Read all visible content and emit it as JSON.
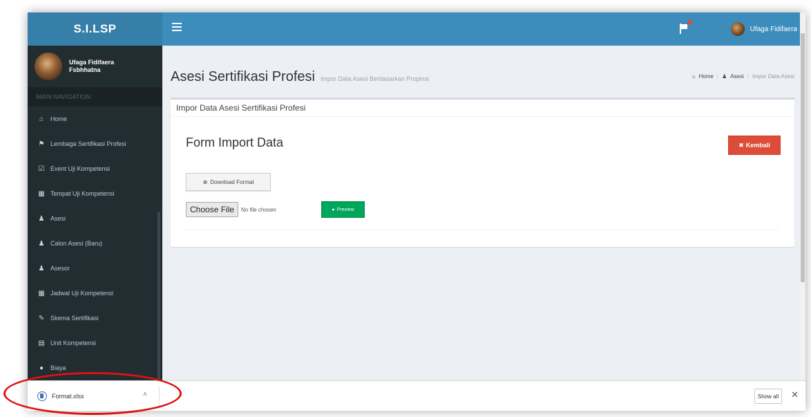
{
  "header": {
    "logo_text": "S.I.LSP",
    "user_name": "Ufaga Fidifaera",
    "hamburger_icon": "menu-icon",
    "notification_icon": "flag-icon",
    "notification_color": "#dd4b39"
  },
  "sidebar": {
    "user_name": "Ufaga Fidifaera Fsbhhatna",
    "section_header": "MAIN NAVIGATION",
    "items": [
      {
        "label": "Home",
        "icon": "⌂"
      },
      {
        "label": "Lembaga Sertifikasi Profesi",
        "icon": "⚑"
      },
      {
        "label": "Event Uji Kompetensi",
        "icon": "☑"
      },
      {
        "label": "Tempat Uji Kompetensi",
        "icon": "▦"
      },
      {
        "label": "Asesi",
        "icon": "♟"
      },
      {
        "label": "Calon Asesi (Baru)",
        "icon": "♟"
      },
      {
        "label": "Asesor",
        "icon": "♟"
      },
      {
        "label": "Jadwal Uji Kompetensi",
        "icon": "▦"
      },
      {
        "label": "Skema Sertifikasi",
        "icon": "✎"
      },
      {
        "label": "Unit Kompetensi",
        "icon": "▤"
      },
      {
        "label": "Biaya",
        "icon": "●"
      }
    ]
  },
  "page": {
    "title": "Asesi Sertifikasi Profesi",
    "subtitle": "Impor Data Asesi Berdasarkan Propinsi",
    "breadcrumb": {
      "home": "Home",
      "asesi": "Asesi",
      "current": "Impor Data Asesi"
    }
  },
  "box": {
    "title": "Impor Data Asesi Sertifikasi Profesi",
    "form_title": "Form Import Data",
    "kembali_label": "Kembali",
    "download_label": "Download Format",
    "choose_file_label": "Choose File",
    "no_file_text": "No file chosen",
    "preview_label": "Preview"
  },
  "download_bar": {
    "file_name": "Format.xlsx",
    "show_all_label": "Show all",
    "close_symbol": "✕",
    "chevron_symbol": "˄"
  },
  "colors": {
    "header_blue": "#3c8dbc",
    "logo_blue": "#367fa9",
    "sidebar_dark": "#222d32",
    "danger_red": "#dd4b39",
    "success_green": "#00a65a",
    "annotation_red": "#e01010"
  }
}
